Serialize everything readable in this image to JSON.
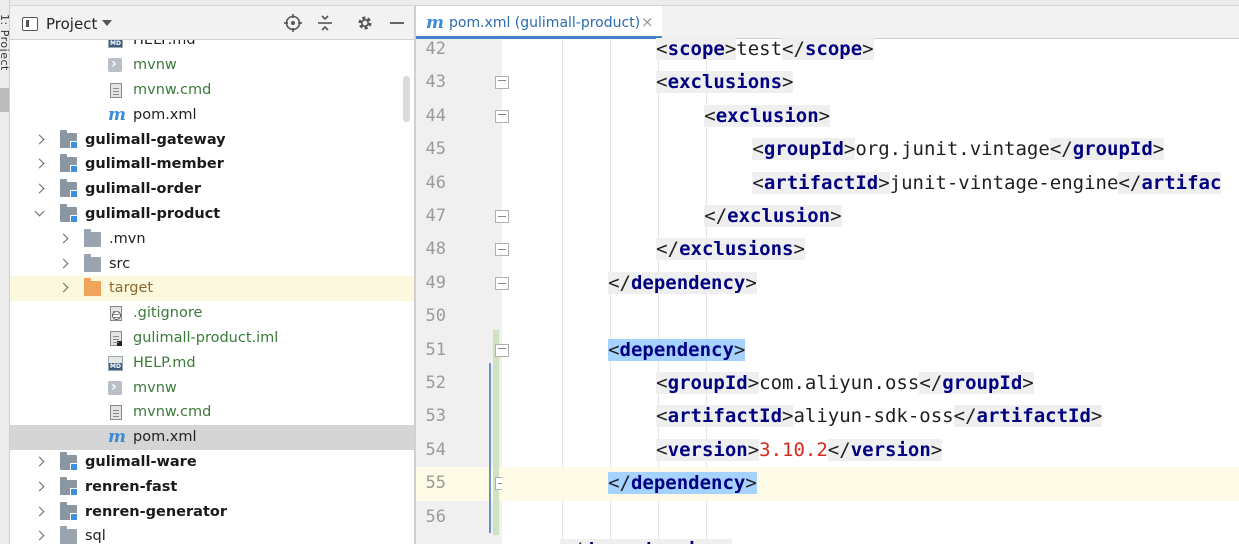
{
  "tool_window_label": "1: Project",
  "project_panel": {
    "title": "Project",
    "tree": [
      {
        "label": "HELP.md",
        "icon": "markdown-file-icon",
        "indent": 3,
        "style": "plain",
        "clipped": true
      },
      {
        "label": "mvnw",
        "icon": "terminal-script-icon",
        "indent": 3,
        "style": "green"
      },
      {
        "label": "mvnw.cmd",
        "icon": "text-file-icon",
        "indent": 3,
        "style": "green"
      },
      {
        "label": "pom.xml",
        "icon": "maven-icon",
        "indent": 3,
        "style": "plain"
      },
      {
        "label": "gulimall-gateway",
        "icon": "module-folder-icon",
        "indent": 1,
        "style": "module",
        "arrow": "right"
      },
      {
        "label": "gulimall-member",
        "icon": "module-folder-icon",
        "indent": 1,
        "style": "module",
        "arrow": "right"
      },
      {
        "label": "gulimall-order",
        "icon": "module-folder-icon",
        "indent": 1,
        "style": "module",
        "arrow": "right"
      },
      {
        "label": "gulimall-product",
        "icon": "module-folder-icon",
        "indent": 1,
        "style": "module",
        "arrow": "down"
      },
      {
        "label": ".mvn",
        "icon": "folder-icon",
        "indent": 2,
        "style": "plain",
        "arrow": "right"
      },
      {
        "label": "src",
        "icon": "folder-icon",
        "indent": 2,
        "style": "plain",
        "arrow": "right"
      },
      {
        "label": "target",
        "icon": "excluded-folder-icon",
        "indent": 2,
        "style": "brown",
        "arrow": "right",
        "highlight": true
      },
      {
        "label": ".gitignore",
        "icon": "gitignore-file-icon",
        "indent": 3,
        "style": "green"
      },
      {
        "label": "gulimall-product.iml",
        "icon": "iml-file-icon",
        "indent": 3,
        "style": "green"
      },
      {
        "label": "HELP.md",
        "icon": "markdown-file-icon",
        "indent": 3,
        "style": "green"
      },
      {
        "label": "mvnw",
        "icon": "terminal-script-icon",
        "indent": 3,
        "style": "green"
      },
      {
        "label": "mvnw.cmd",
        "icon": "text-file-icon",
        "indent": 3,
        "style": "green"
      },
      {
        "label": "pom.xml",
        "icon": "maven-icon",
        "indent": 3,
        "style": "plain",
        "selected": true
      },
      {
        "label": "gulimall-ware",
        "icon": "module-folder-icon",
        "indent": 1,
        "style": "module",
        "arrow": "right"
      },
      {
        "label": "renren-fast",
        "icon": "module-folder-icon",
        "indent": 1,
        "style": "module",
        "arrow": "right"
      },
      {
        "label": "renren-generator",
        "icon": "module-folder-icon",
        "indent": 1,
        "style": "module",
        "arrow": "right"
      },
      {
        "label": "sql",
        "icon": "folder-icon",
        "indent": 1,
        "style": "plain",
        "arrow": "right"
      }
    ]
  },
  "editor": {
    "tab_label": "pom.xml (gulimall-product)",
    "current_line": 55,
    "lines": [
      {
        "n": "42",
        "indent": 2,
        "parts": [
          [
            "tag",
            "<scope>"
          ],
          [
            "text",
            "test"
          ],
          [
            "tag",
            "</scope>"
          ]
        ]
      },
      {
        "n": "43",
        "indent": 2,
        "parts": [
          [
            "tag",
            "<exclusions>"
          ]
        ],
        "fold": "open"
      },
      {
        "n": "44",
        "indent": 3,
        "parts": [
          [
            "tag",
            "<exclusion>"
          ]
        ],
        "fold": "open"
      },
      {
        "n": "45",
        "indent": 4,
        "parts": [
          [
            "tag",
            "<groupId>"
          ],
          [
            "text",
            "org.junit.vintage"
          ],
          [
            "tag",
            "</groupId>"
          ]
        ]
      },
      {
        "n": "46",
        "indent": 4,
        "parts": [
          [
            "tag",
            "<artifactId>"
          ],
          [
            "text",
            "junit-vintage-engine"
          ],
          [
            "tag",
            "</artifac"
          ]
        ]
      },
      {
        "n": "47",
        "indent": 3,
        "parts": [
          [
            "tag",
            "</exclusion>"
          ]
        ],
        "fold": "close"
      },
      {
        "n": "48",
        "indent": 2,
        "parts": [
          [
            "tag",
            "</exclusions>"
          ]
        ],
        "fold": "close"
      },
      {
        "n": "49",
        "indent": 1,
        "parts": [
          [
            "tag",
            "</dependency>"
          ]
        ],
        "fold": "close"
      },
      {
        "n": "50",
        "indent": 0,
        "parts": []
      },
      {
        "n": "51",
        "indent": 1,
        "parts": [
          [
            "tagsel",
            "<dependency>"
          ]
        ],
        "fold": "open"
      },
      {
        "n": "52",
        "indent": 2,
        "parts": [
          [
            "tag",
            "<groupId>"
          ],
          [
            "text",
            "com.aliyun.oss"
          ],
          [
            "tag",
            "</groupId>"
          ]
        ]
      },
      {
        "n": "53",
        "indent": 2,
        "parts": [
          [
            "tag",
            "<artifactId>"
          ],
          [
            "text",
            "aliyun-sdk-oss"
          ],
          [
            "tag",
            "</artifactId>"
          ]
        ]
      },
      {
        "n": "54",
        "indent": 2,
        "parts": [
          [
            "tag",
            "<version>"
          ],
          [
            "val",
            "3.10.2"
          ],
          [
            "tag",
            "</version>"
          ]
        ]
      },
      {
        "n": "55",
        "indent": 1,
        "parts": [
          [
            "tagsel",
            "</dependency>"
          ]
        ],
        "fold": "close"
      },
      {
        "n": "56",
        "indent": 0,
        "parts": []
      },
      {
        "n": "",
        "indent": 0,
        "parts": [
          [
            "tag",
            "</dependencies>"
          ]
        ],
        "clipped": true
      }
    ]
  }
}
